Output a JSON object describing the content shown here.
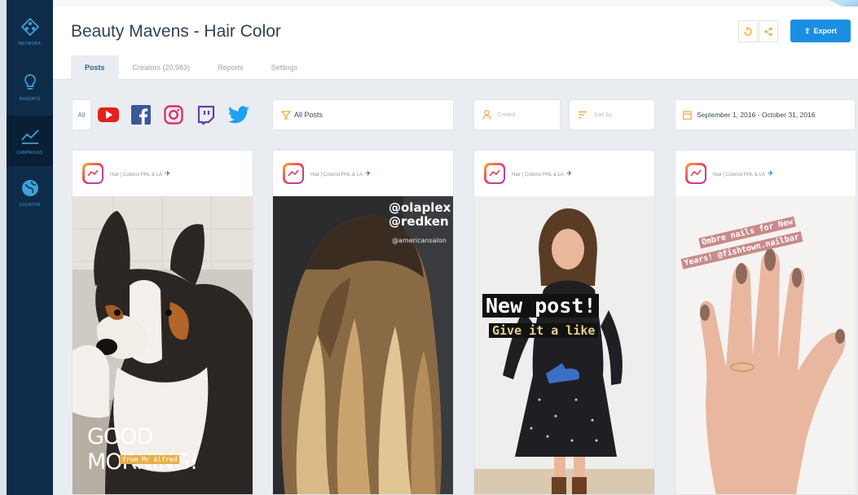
{
  "nav": [
    {
      "label": "NETWORK",
      "icon": "network-icon"
    },
    {
      "label": "INSIGHTS",
      "icon": "lightbulb-icon"
    },
    {
      "label": "CAMPAIGNS",
      "icon": "chart-line-icon"
    },
    {
      "label": "LOCATOR",
      "icon": "globe-icon"
    }
  ],
  "header": {
    "title": "Beauty Mavens - Hair Color",
    "export_label": "Export",
    "tabs": [
      "Posts",
      "Creators (20,983)",
      "Reports",
      "Settings"
    ]
  },
  "filters": {
    "all_label": "All",
    "social_icons": [
      "youtube-icon",
      "facebook-icon",
      "instagram-icon",
      "twitch-icon",
      "twitter-icon"
    ],
    "post_filter": "All Posts",
    "creator_placeholder": "Creator",
    "sort_placeholder": "Sort by",
    "date_range": "September 1, 2016 - October 31, 2016"
  },
  "cards": [
    {
      "label": "Hair | Colorist PHL & LA",
      "overlay": "GOOD MORNING!",
      "overlay_sub": "from Mr Alfred"
    },
    {
      "label": "Hair | Colorist PHL & LA",
      "overlay": "@olaplex",
      "overlay_2": "@redken",
      "overlay_sub": "@americansalon"
    },
    {
      "label": "Hair | Colorist PHL & LA",
      "overlay": "New post!",
      "overlay_sub": "Give it a like"
    },
    {
      "label": "Hair | Colorist PHL & LA",
      "overlay": "Ombre nails for New",
      "overlay_sub": "Years! @fishtown.nailbar"
    }
  ],
  "colors": {
    "sidebar": "#0e2c4a",
    "accent": "#1a8ee0",
    "nav_icon": "#3fa0d8"
  }
}
